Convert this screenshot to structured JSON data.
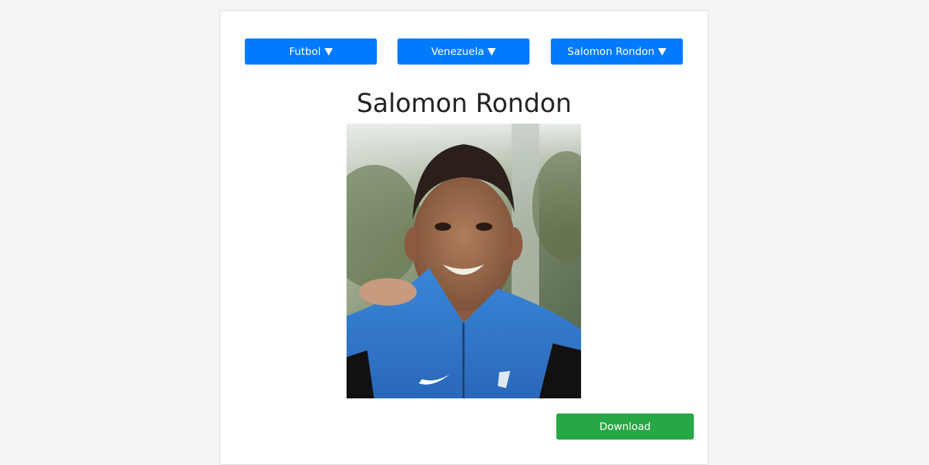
{
  "selectors": {
    "sport": "Futbol",
    "country": "Venezuela",
    "player": "Salomon Rondon"
  },
  "player_title": "Salomon Rondon",
  "photo": {
    "alt": "Salomon Rondon"
  },
  "download_label": "Download",
  "colors": {
    "primary": "#007bff",
    "success": "#28a745",
    "background": "#f3f4f6"
  }
}
